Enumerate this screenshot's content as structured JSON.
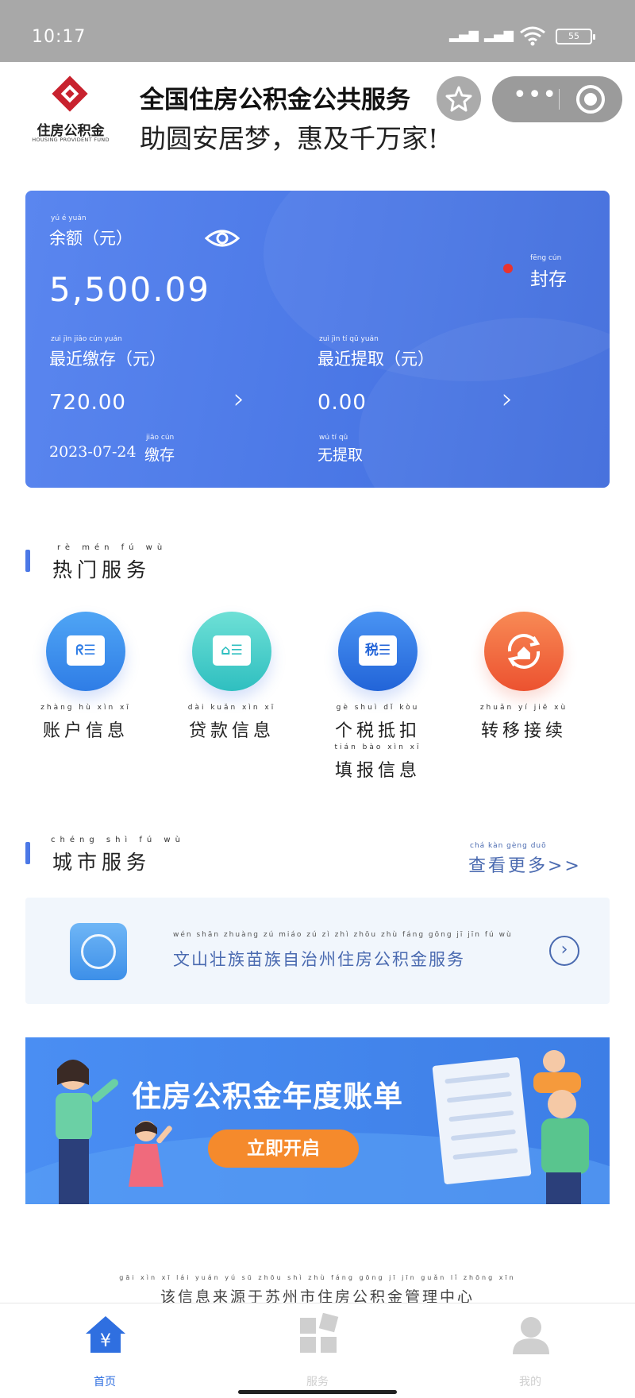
{
  "status_bar": {
    "time": "10:17",
    "battery": "55"
  },
  "header": {
    "logo_cn": "住房公积金",
    "logo_en": "HOUSING PROVIDENT FUND",
    "title": "全国住房公积金公共服务",
    "slogan": "助圆安居梦，惠及千万家!"
  },
  "account": {
    "balance_label": "余额（元）",
    "balance_label_pinyin": "yú é  yuán",
    "balance": "5,500.09",
    "status": "封存",
    "status_pinyin": "fēng cún",
    "recent_deposit_label": "最近缴存（元）",
    "recent_deposit_pinyin": "zuì jìn jiǎo cún  yuán",
    "recent_deposit_amount": "720.00",
    "recent_deposit_date": "2023-07-24",
    "deposit_word": "缴存",
    "deposit_word_pinyin": "jiǎo cún",
    "recent_withdraw_label": "最近提取（元）",
    "recent_withdraw_pinyin": "zuì jìn tí qǔ  yuán",
    "recent_withdraw_amount": "0.00",
    "no_withdraw": "无提取",
    "no_withdraw_pinyin": "wú tí qǔ"
  },
  "hot_services": {
    "title": "热门服务",
    "title_pinyin": "rè mén fú wù",
    "items": [
      {
        "label": "账户信息",
        "pinyin": "zhàng hù xìn xī",
        "icon": "id-card-icon",
        "glyph": "ᖇ☰",
        "color": "#3d8fe8"
      },
      {
        "label": "贷款信息",
        "pinyin": "dài kuǎn xìn xī",
        "icon": "loan-card-icon",
        "glyph": "⌂☰",
        "color": "#3ec9c6"
      },
      {
        "label": "个税抵扣",
        "label2": "填报信息",
        "pinyin": "gè shuì dǐ kòu",
        "pinyin2": "tián bào xìn xī",
        "icon": "tax-icon",
        "glyph": "税☰",
        "color": "#2f7de6"
      },
      {
        "label": "转移接续",
        "pinyin": "zhuǎn yí jiē xù",
        "icon": "transfer-icon",
        "glyph": "⟳",
        "color": "#f0633a"
      }
    ]
  },
  "city_services": {
    "title": "城市服务",
    "title_pinyin": "chéng shì fú wù",
    "more": "查看更多>>",
    "more_pinyin": "chá kàn gèng duō",
    "item": "文山壮族苗族自治州住房公积金服务",
    "item_pinyin": "wén shān zhuàng zú miáo zú zì zhì zhōu zhù fáng gōng jī jīn fú wù"
  },
  "banner": {
    "headline": "住房公积金年度账单",
    "cta": "立即开启"
  },
  "footer_note": "该信息来源于苏州市住房公积金管理中心",
  "footer_note_pinyin": "gāi xìn xī lái yuán yú sū zhōu shì zhù fáng gōng jī jīn guǎn lǐ zhōng xīn",
  "tabs": [
    {
      "label": "首页",
      "icon": "home-icon",
      "active": true
    },
    {
      "label": "服务",
      "icon": "grid-icon",
      "active": false
    },
    {
      "label": "我的",
      "icon": "user-icon",
      "active": false
    }
  ],
  "colors": {
    "primary": "#4b78e6",
    "accent_orange": "#f58a2c",
    "status_red": "#e8332f",
    "link": "#4a6ab0"
  }
}
